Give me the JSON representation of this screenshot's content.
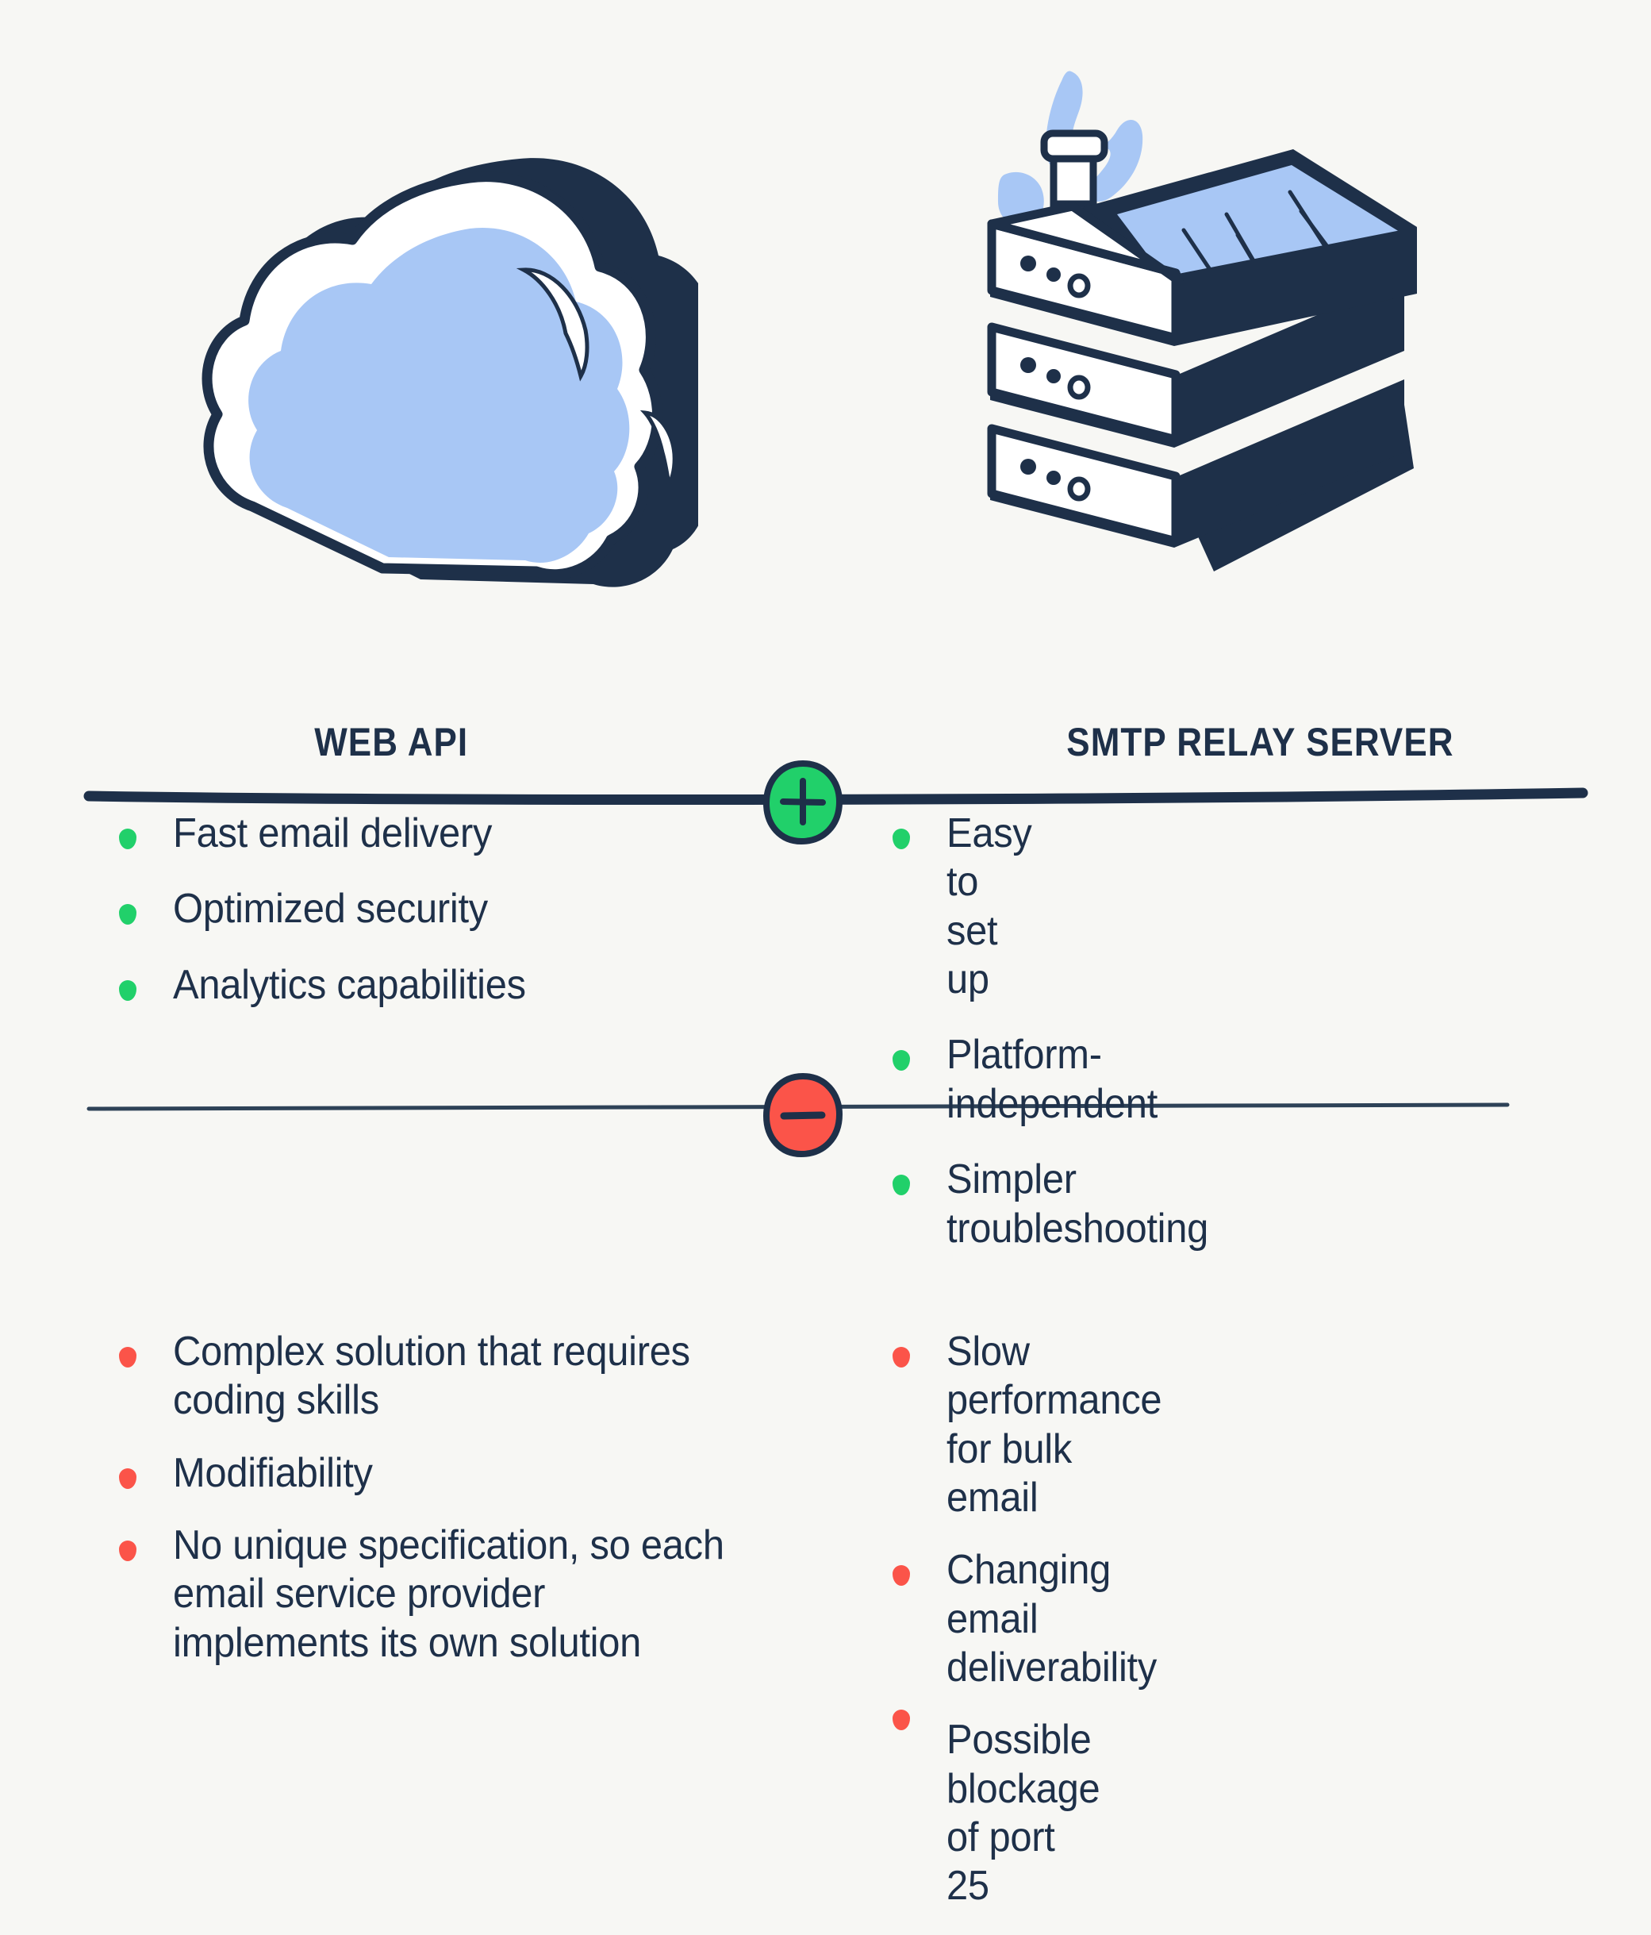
{
  "page": {
    "background_color": "#F7F7F4",
    "text_color": "#1E3049",
    "accent_green": "#21D06A",
    "accent_red": "#FB5449",
    "accent_blue": "#A8C7F5"
  },
  "columns": {
    "left": {
      "heading": "WEB API",
      "illustration": "cloud-illustration",
      "pros": [
        "Fast email delivery",
        "Optimized security",
        "Analytics capabilities"
      ],
      "cons": [
        "Complex solution that requires coding skills",
        "Modifiability",
        "No unique specification, so each email service provider implements its own solution"
      ]
    },
    "right": {
      "heading": "SMTP RELAY SERVER",
      "illustration": "server-stack-illustration",
      "pros": [
        "Easy to set up",
        "Platform-independent",
        "Simpler troubleshooting"
      ],
      "cons": [
        "Slow performance for bulk email",
        "Changing email deliverability",
        "Possible blockage of port 25"
      ]
    }
  },
  "badges": {
    "pros_badge": {
      "symbol": "+",
      "name": "plus-badge",
      "color": "#21D06A"
    },
    "cons_badge": {
      "symbol": "–",
      "name": "minus-badge",
      "color": "#FB5449"
    }
  },
  "dividers": {
    "top": "thick-hand-drawn-rule",
    "bottom": "thin-rule"
  }
}
